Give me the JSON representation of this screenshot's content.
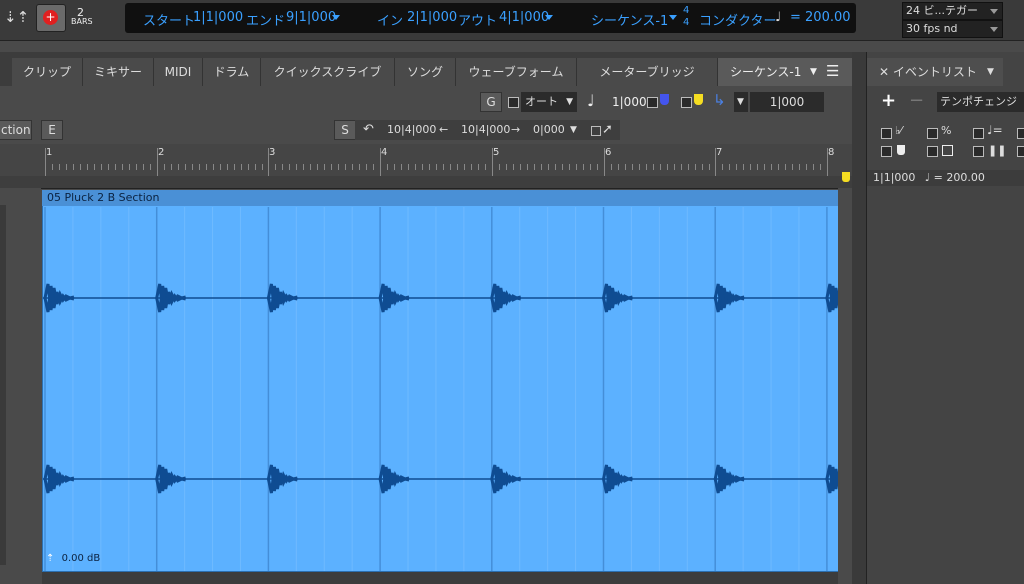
{
  "transport": {
    "bars_count": "2",
    "bars_label": "BARS",
    "start_label": "スタート",
    "start_value": "1|1|000",
    "end_label": "エンド",
    "end_value": "9|1|000",
    "in_label": "イン",
    "in_value": "2|1|000",
    "out_label": "アウト",
    "out_value": "4|1|000",
    "sequence": "シーケンス-1",
    "meter_top": "4",
    "meter_bottom": "4",
    "conductor_label": "コンダクター",
    "tempo": "= 200.00",
    "sync_select": "24 ビ...テガー",
    "fps_select": "30 fps nd"
  },
  "tabs": [
    "クリップ",
    "ミキサー",
    "MIDI",
    "ドラム",
    "クイックスクライブ",
    "ソング",
    "ウェーブフォーム",
    "メーターブリッジ",
    "シーケンス-1"
  ],
  "toolbar": {
    "g_button": "G",
    "auto_select": "オート",
    "grid_value": "1|000",
    "position_value": "1|000",
    "section_label": "ction",
    "e_button": "E",
    "s_button": "S",
    "loop_start": "10|4|000",
    "loop_end": "10|4|000",
    "nudge_value": "0|000"
  },
  "ruler": {
    "bars": [
      "1",
      "2",
      "3",
      "4",
      "5",
      "6",
      "7",
      "8"
    ]
  },
  "clip": {
    "name": "05 Pluck 2 B Section",
    "gain": "0.00 dB"
  },
  "event_list": {
    "title": "イベントリスト",
    "type_select": "テンポチェンジ",
    "row_position": "1|1|000",
    "row_value": "= 200.00"
  },
  "colors": {
    "waveform_bg": "#5cb1ff",
    "waveform": "#0f4c92",
    "accent": "#3aa0ff"
  }
}
